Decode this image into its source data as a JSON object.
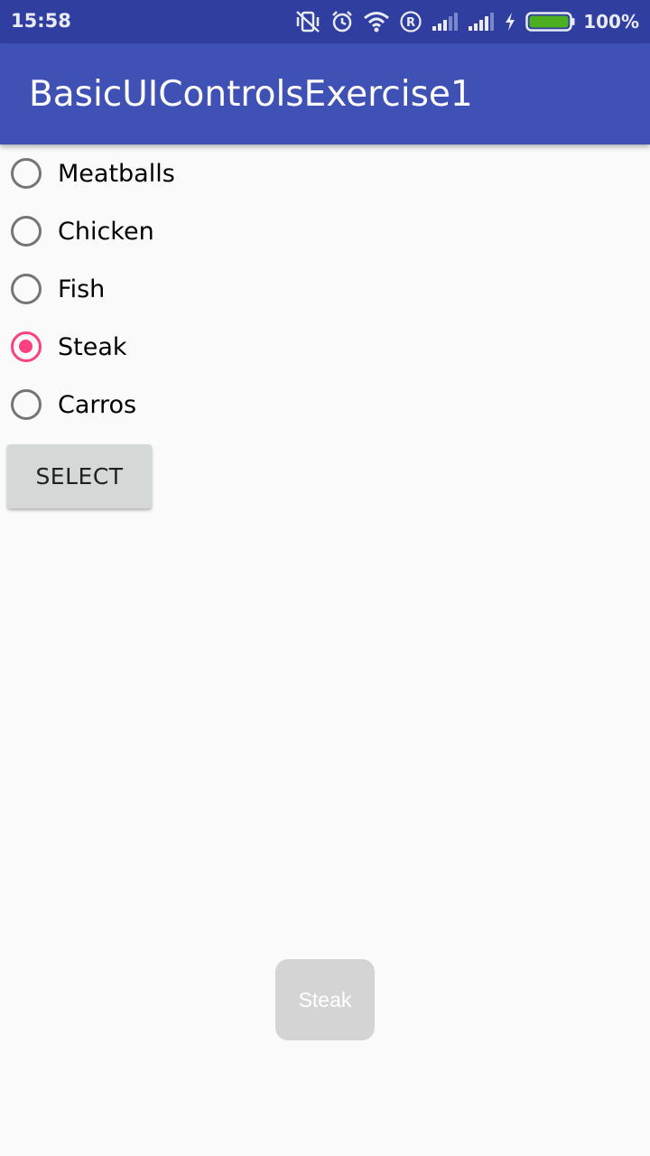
{
  "status_bar": {
    "time": "15:58",
    "icons": [
      "vibrate-icon",
      "alarm-icon",
      "wifi-icon",
      "roaming-r-icon",
      "signal-icon",
      "signal-icon",
      "charging-icon",
      "battery-icon"
    ],
    "battery_percent": "100%",
    "battery_level": 1.0
  },
  "app_bar": {
    "title": "BasicUIControlsExercise1"
  },
  "radio_group": {
    "options": [
      {
        "label": "Meatballs",
        "checked": false
      },
      {
        "label": "Chicken",
        "checked": false
      },
      {
        "label": "Fish",
        "checked": false
      },
      {
        "label": "Steak",
        "checked": true
      },
      {
        "label": "Carros",
        "checked": false
      }
    ]
  },
  "select_button": {
    "label": "SELECT"
  },
  "toast": {
    "text": "Steak"
  },
  "colors": {
    "status_bar": "#303f9f",
    "app_bar": "#3f51b5",
    "accent": "#ff4081",
    "background": "#fafafa",
    "button": "#d6d7d7",
    "battery_fill": "#4caf20"
  }
}
